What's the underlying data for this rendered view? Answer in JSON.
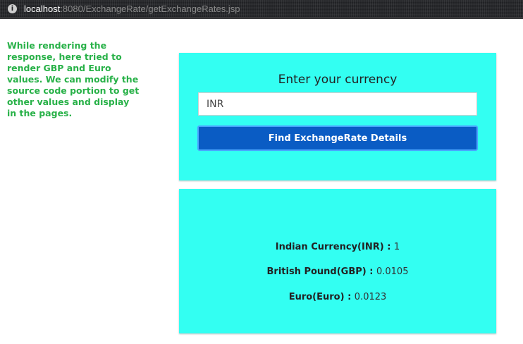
{
  "browser": {
    "url_host": "localhost",
    "url_rest": ":8080/ExchangeRate/getExchangeRates.jsp"
  },
  "side_note": "While rendering the response, here tried to render GBP and Euro values. We can modify the source code portion to get other values and display in the pages.",
  "form": {
    "title": "Enter your currency",
    "input_value": "INR",
    "button_label": "Find ExchangeRate Details"
  },
  "results": [
    {
      "label": "Indian Currency(INR) : ",
      "value": "1"
    },
    {
      "label": "British Pound(GBP) : ",
      "value": "0.0105"
    },
    {
      "label": "Euro(Euro) : ",
      "value": "0.0123"
    }
  ],
  "colors": {
    "card_background": "#33fff2",
    "note_text": "#28b148",
    "button_background": "#0a5cc4"
  }
}
